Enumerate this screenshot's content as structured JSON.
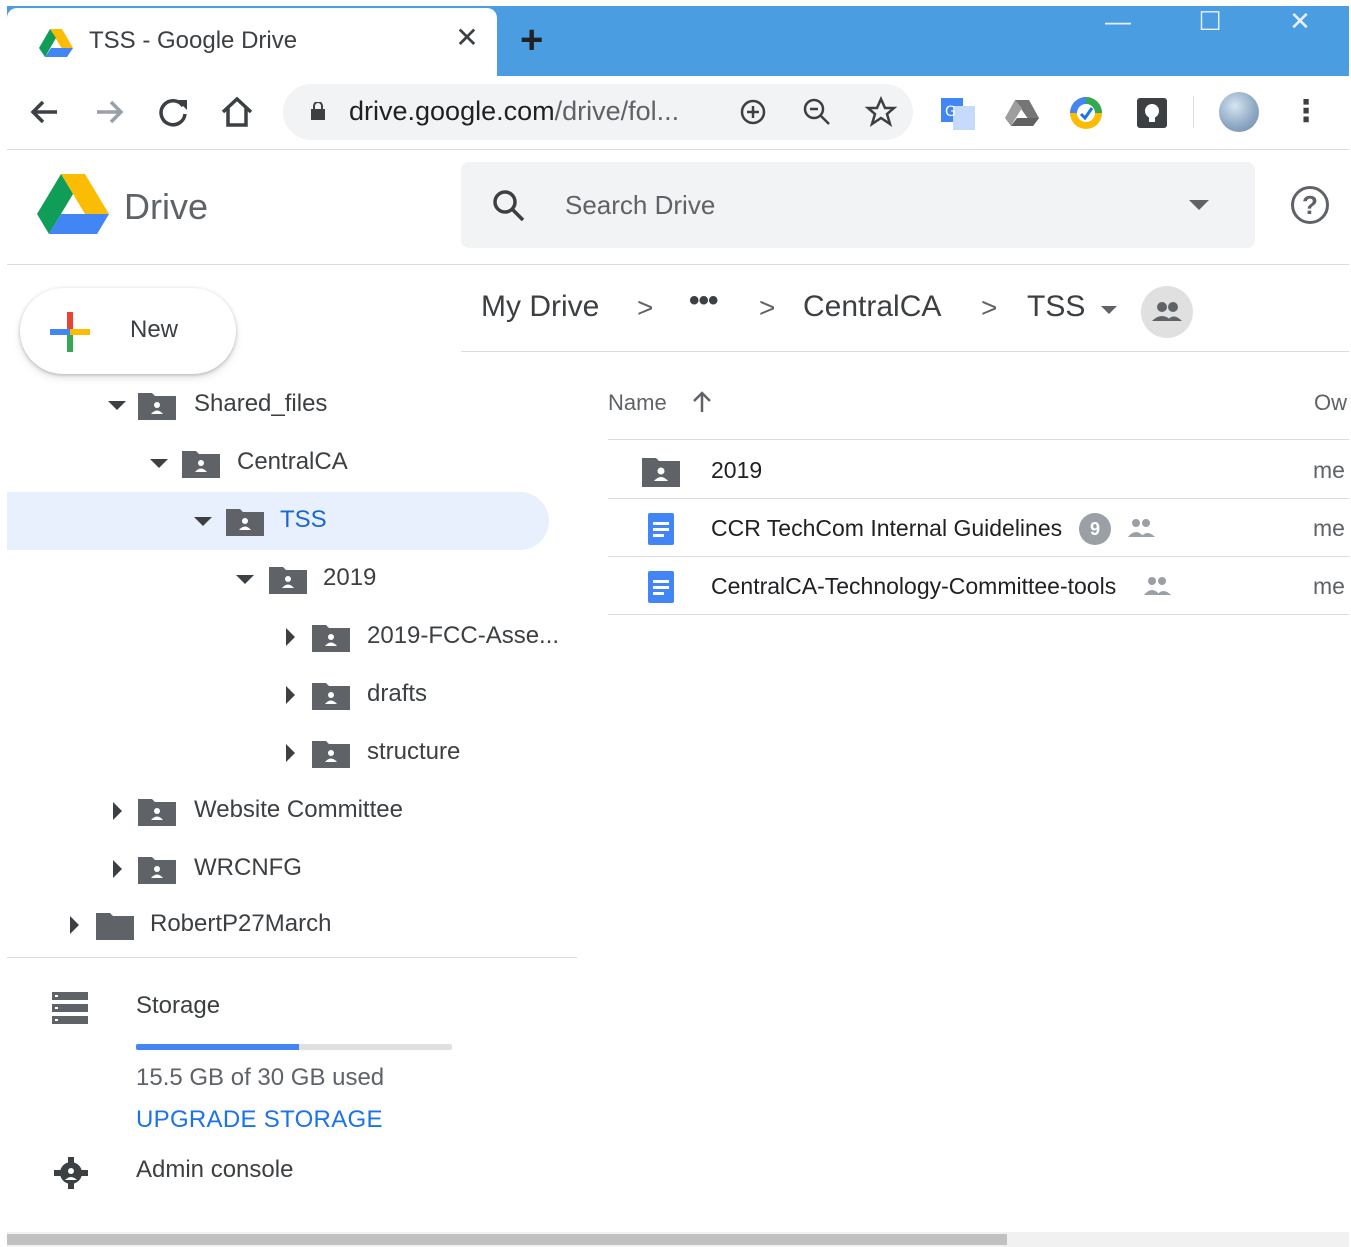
{
  "browser": {
    "tab_title": "TSS - Google Drive",
    "tab_close": "✕",
    "new_tab": "+",
    "window_controls": {
      "minimize": "—",
      "maximize": "☐",
      "close": "✕"
    },
    "url_host": "drive.google.com",
    "url_path": "/drive/fol...",
    "icons": [
      "back-arrow-icon",
      "forward-arrow-icon",
      "reload-icon",
      "home-icon",
      "lock-icon",
      "add-icon",
      "zoom-out-icon",
      "star-icon",
      "translate-icon",
      "drive-extension-icon",
      "chrome-extension-icon",
      "keep-extension-icon",
      "avatar",
      "kebab-menu-icon"
    ]
  },
  "header": {
    "app_name": "Drive",
    "search_placeholder": "Search Drive"
  },
  "new_button": {
    "label": "New"
  },
  "tree": [
    {
      "label": "Shared_files",
      "expanded": true,
      "selected": false,
      "shared": true
    },
    {
      "label": "CentralCA",
      "expanded": true,
      "selected": false,
      "shared": true
    },
    {
      "label": "TSS",
      "expanded": true,
      "selected": true,
      "shared": true
    },
    {
      "label": "2019",
      "expanded": true,
      "selected": false,
      "shared": true
    },
    {
      "label": "2019-FCC-Asse...",
      "expanded": false,
      "selected": false,
      "shared": true
    },
    {
      "label": "drafts",
      "expanded": false,
      "selected": false,
      "shared": true
    },
    {
      "label": "structure",
      "expanded": false,
      "selected": false,
      "shared": true
    },
    {
      "label": "Website Committee",
      "expanded": false,
      "selected": false,
      "shared": true
    },
    {
      "label": "WRCNFG",
      "expanded": false,
      "selected": false,
      "shared": true
    },
    {
      "label": "RobertP27March",
      "expanded": false,
      "selected": false,
      "shared": false
    }
  ],
  "storage": {
    "label": "Storage",
    "used_text": "15.5 GB of 30 GB used",
    "used_fraction": 0.517,
    "upgrade_label": "UPGRADE STORAGE"
  },
  "admin": {
    "label": "Admin console"
  },
  "breadcrumb": {
    "items": [
      "My Drive",
      "•••",
      "CentralCA",
      "TSS"
    ],
    "separator": ">"
  },
  "columns": {
    "name": "Name",
    "owner": "Ow"
  },
  "files": [
    {
      "name": "2019",
      "type": "shared-folder",
      "badge": "",
      "shared": false,
      "owner": "me"
    },
    {
      "name": "CCR TechCom Internal Guidelines",
      "type": "doc",
      "badge": "9",
      "shared": true,
      "owner": "me"
    },
    {
      "name": "CentralCA-Technology-Committee-tools",
      "type": "doc",
      "badge": "",
      "shared": true,
      "owner": "me"
    }
  ],
  "colors": {
    "titlebar": "#4a9de0",
    "selected_bg": "#e8f0fe",
    "selected_text": "#1967d2",
    "accent": "#1a73e8",
    "doc_blue": "#4285f4",
    "folder_gray": "#5f6368"
  }
}
